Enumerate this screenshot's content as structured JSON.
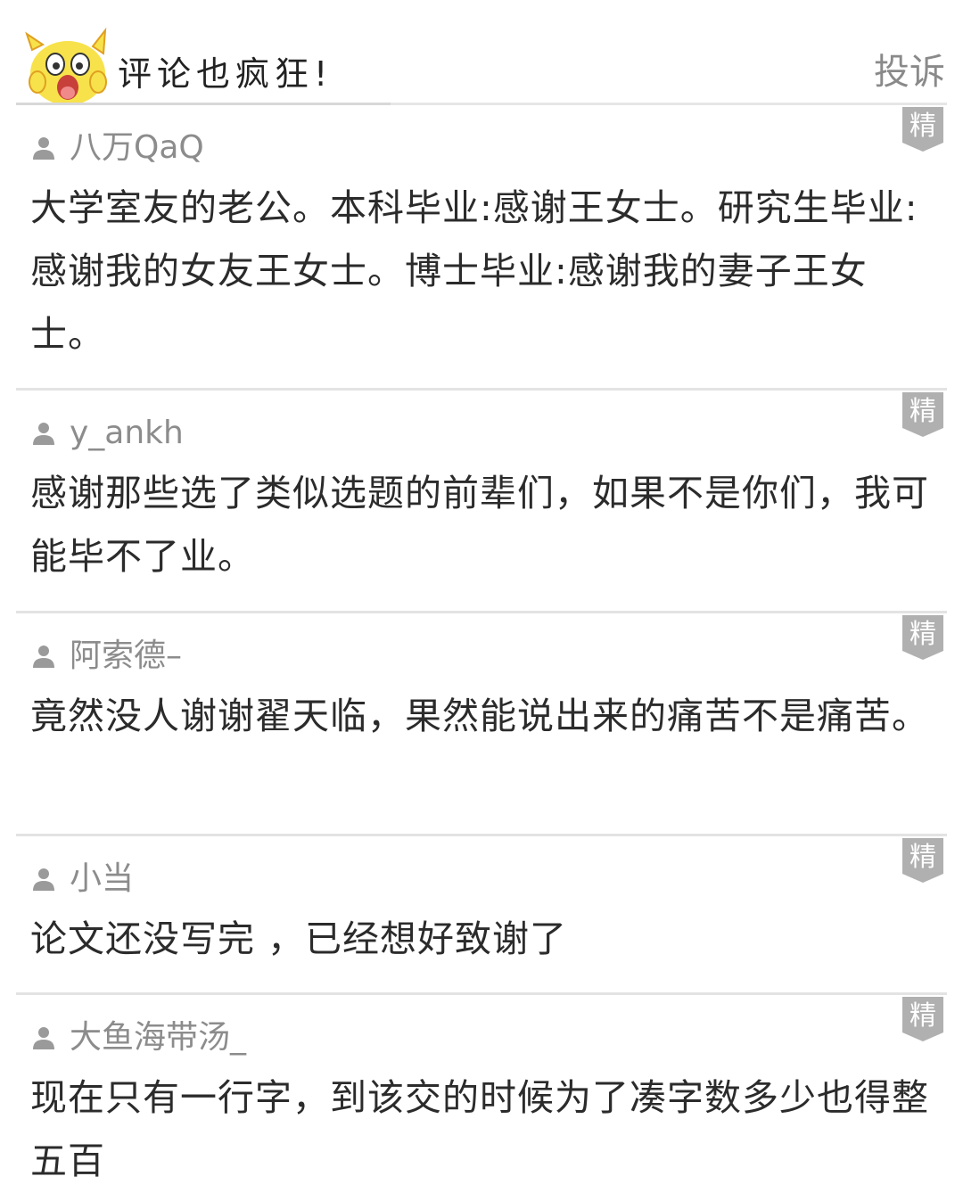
{
  "header": {
    "title": "评论也疯狂!",
    "report_label": "投诉",
    "mascot_icon": "yellow-cartoon-mascot-icon"
  },
  "colors": {
    "username": "#8c8c8c",
    "text": "#2b2b2b",
    "badge": "#b0b0b0",
    "separator": "#e3e3e3"
  },
  "comments": [
    {
      "user": "八万QaQ",
      "badge": "精",
      "text": "大学室友的老公。本科毕业:感谢王女士。研究生毕业:感谢我的女友王女士。博士毕业:感谢我的妻子王女士。"
    },
    {
      "user": "y_ankh",
      "badge": "精",
      "text": "感谢那些选了类似选题的前辈们，如果不是你们，我可能毕不了业。"
    },
    {
      "user": "阿索德–",
      "badge": "精",
      "text": "竟然没人谢谢翟天临，果然能说出来的痛苦不是痛苦。"
    },
    {
      "user": "小当",
      "badge": "精",
      "text": "论文还没写完 ，已经想好致谢了"
    },
    {
      "user": "大鱼海带汤_",
      "badge": "精",
      "text": "现在只有一行字，到该交的时候为了凑字数多少也得整五百"
    }
  ]
}
